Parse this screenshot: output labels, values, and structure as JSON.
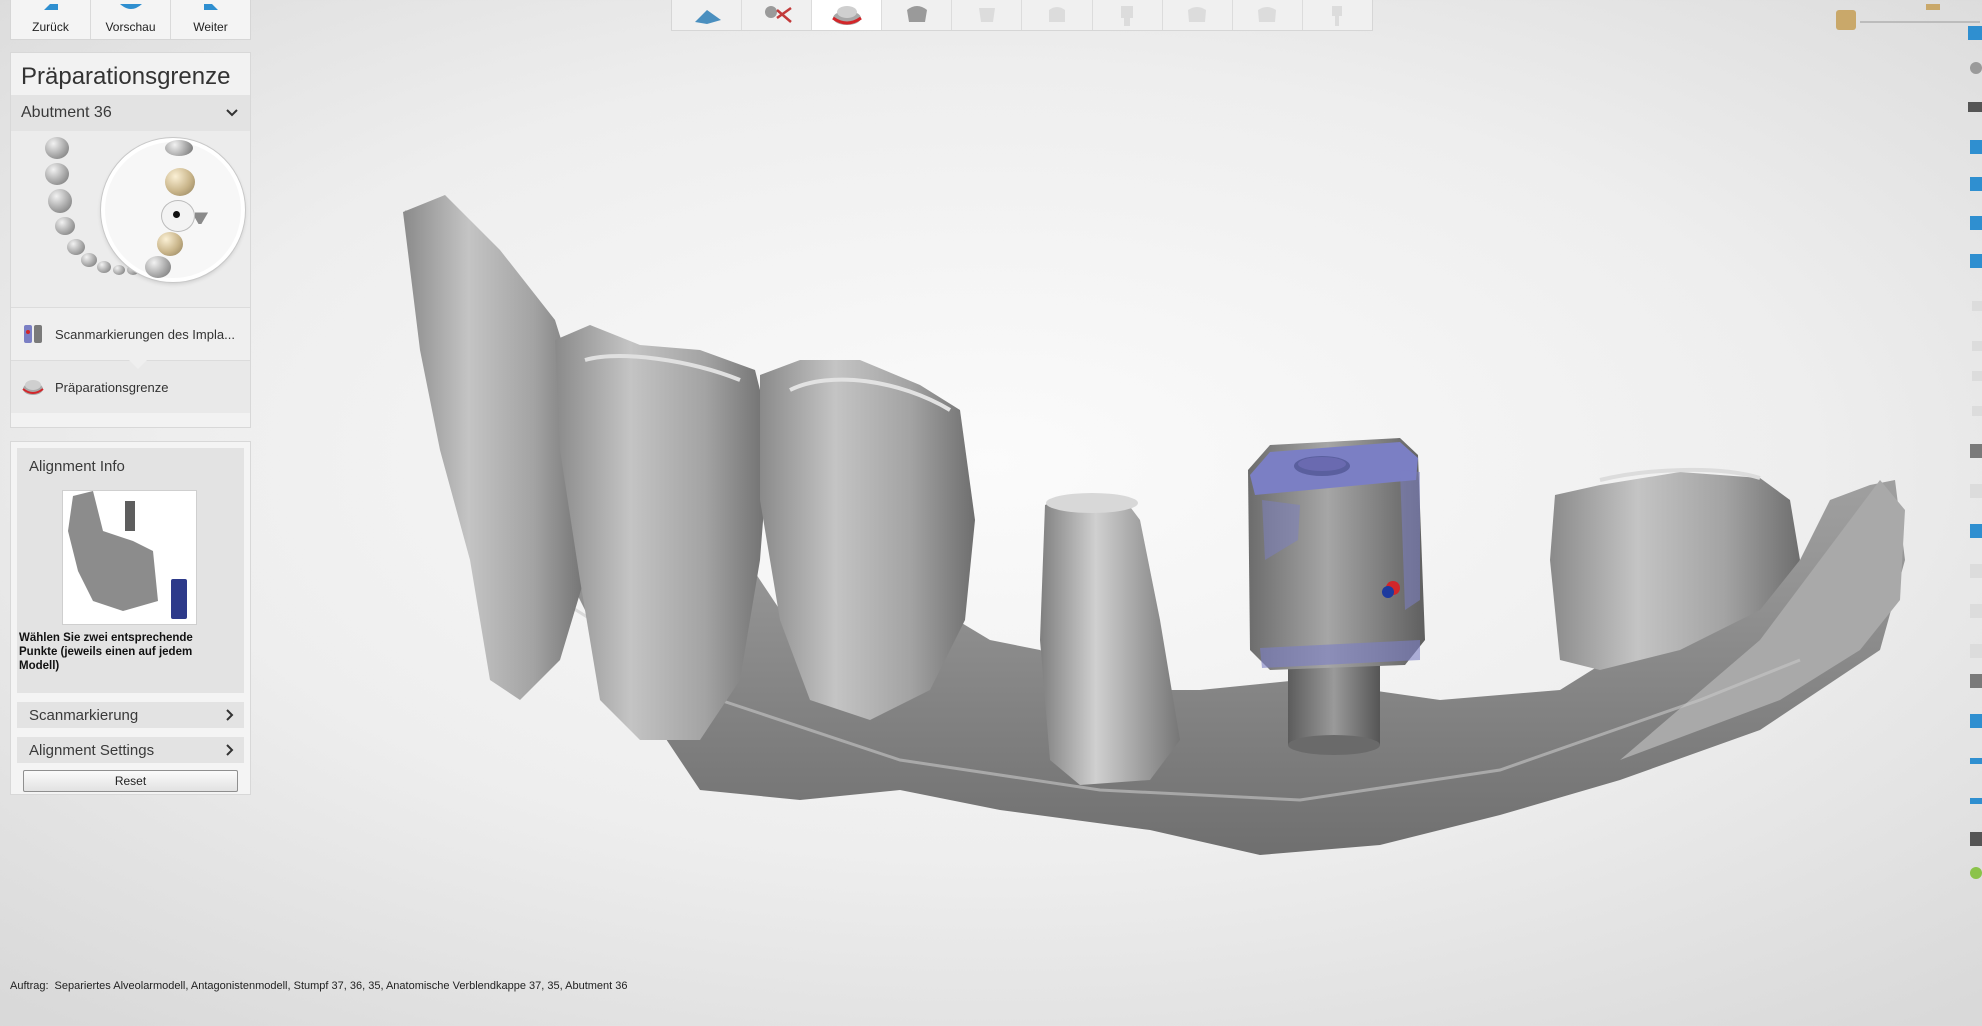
{
  "nav": {
    "back_label": "Zurück",
    "preview_label": "Vorschau",
    "next_label": "Weiter"
  },
  "panel": {
    "title": "Präparationsgrenze",
    "selected_item": "Abutment 36",
    "workflow_steps": [
      {
        "label": "Scanmarkierungen des Impla...",
        "icon": "scanbody-icon"
      },
      {
        "label": "Präparationsgrenze",
        "icon": "margin-line-icon",
        "active": true
      }
    ]
  },
  "alignment": {
    "title": "Alignment Info",
    "instruction": "Wählen Sie zwei entsprechende Punkte (jeweils einen auf jedem Modell)",
    "sections": [
      {
        "label": "Scanmarkierung"
      },
      {
        "label": "Alignment Settings"
      }
    ],
    "reset_label": "Reset"
  },
  "toolbar": {
    "tools": [
      "model-trim-icon",
      "cut-icon",
      "margin-line-icon",
      "crown-icon",
      "tooth-icon-disabled",
      "cap-icon-disabled",
      "abutment-icon-disabled",
      "crown-disabled-icon",
      "pontic-disabled-icon",
      "attachment-disabled-icon"
    ],
    "active_index": 2
  },
  "status": {
    "label": "Auftrag:",
    "text": "Separiertes Alveolarmodell, Antagonistenmodell, Stumpf 37, 36, 35, Anatomische Verblendkappe 37, 35, Abutment 36"
  },
  "colors": {
    "scanbody_blue": "#7b7fc4",
    "marker_red": "#d2262a",
    "marker_blue": "#1d3a9e",
    "model_gray": "#8f8f8f"
  }
}
